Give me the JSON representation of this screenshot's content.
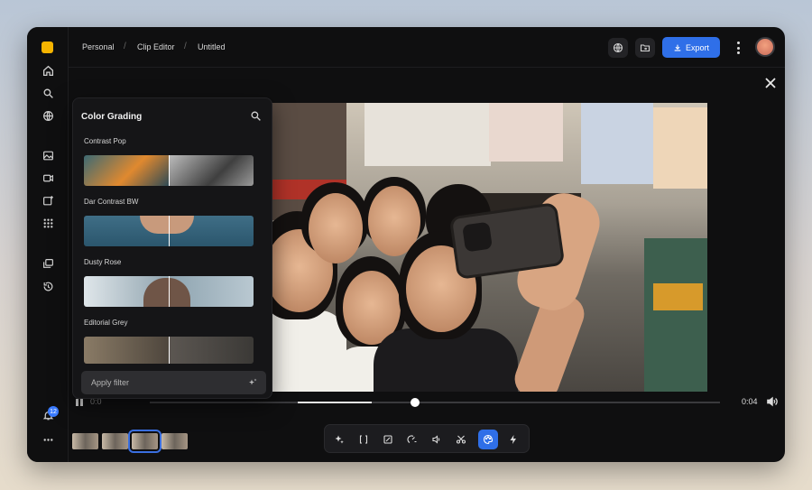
{
  "breadcrumb": [
    "Personal",
    "Clip Editor",
    "Untitled"
  ],
  "header": {
    "export_label": "Export"
  },
  "notifications": {
    "count": "12"
  },
  "player": {
    "current_time": "0:0",
    "total_time": "0:04",
    "progress": 0.21,
    "buffered": 0.39
  },
  "panel": {
    "title": "Color Grading",
    "filters": [
      {
        "name": "Contrast Pop"
      },
      {
        "name": "Dar Contrast BW"
      },
      {
        "name": "Dusty Rose"
      },
      {
        "name": "Editorial Grey"
      }
    ],
    "apply_placeholder": "Apply filter"
  },
  "colors": {
    "accent": "#2f6fe8",
    "background": "#0f0f10",
    "panel": "#151517"
  },
  "sidebar_icons": [
    "home-icon",
    "search-icon",
    "globe-icon",
    "image-icon",
    "video-icon",
    "media-add-icon",
    "grid-icon",
    "layers-icon",
    "history-icon",
    "bell-icon",
    "more-icon"
  ],
  "tools": [
    "magic-icon",
    "trim-icon",
    "crop-icon",
    "speed-icon",
    "audio-icon",
    "cut-icon",
    "color-palette-icon",
    "flash-icon"
  ]
}
